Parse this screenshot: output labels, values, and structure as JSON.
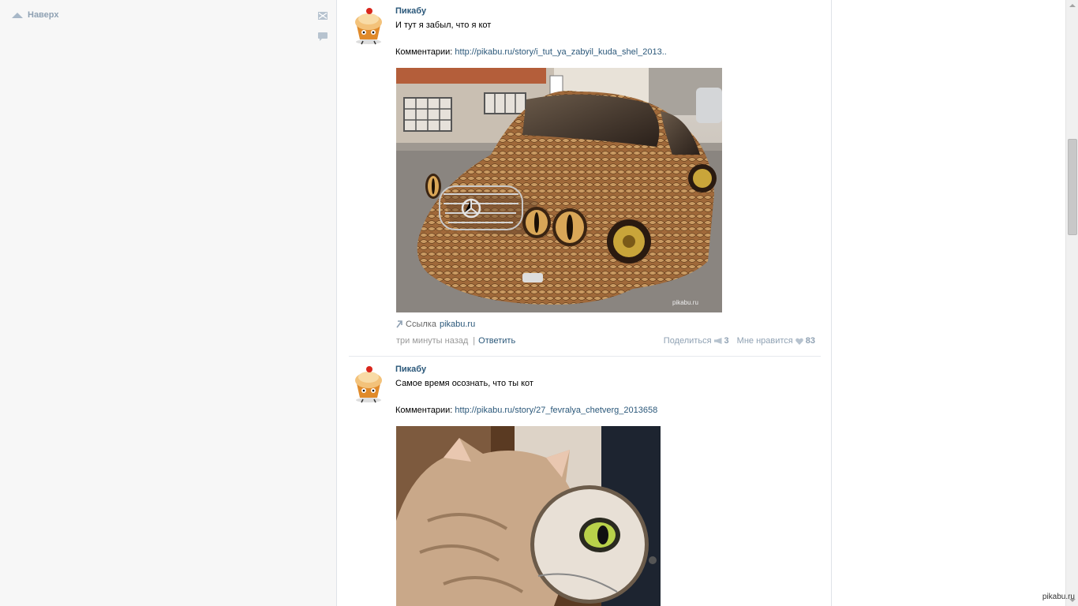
{
  "sidebar": {
    "to_top_label": "Наверх",
    "icons": [
      "envelope-icon",
      "chat-bubble-icon"
    ]
  },
  "posts": [
    {
      "author": "Пикабу",
      "text": "И тут я забыл, что я кот",
      "comments_label": "Комментарии:",
      "comments_link": "http://pikabu.ru/story/i_tut_ya_zabyil_kuda_shel_2013..",
      "image_alt": "Mercedes car painted in snake skin pattern",
      "source_prefix": "Ссылка",
      "source_domain": "pikabu.ru",
      "time": "три минуты назад",
      "separator": "|",
      "reply": "Ответить",
      "share_label": "Поделиться",
      "share_count": "3",
      "like_label": "Мне нравится",
      "like_count": "83"
    },
    {
      "author": "Пикабу",
      "text": "Самое время осознать, что ты кот",
      "comments_label": "Комментарии:",
      "comments_link": "http://pikabu.ru/story/27_fevralya_chetverg_2013658",
      "image_alt": "Cat looking into a magnifying mirror"
    }
  ],
  "watermark": "pikabu.ru",
  "colors": {
    "link": "#2b587a",
    "muted": "#8fa1b3",
    "bg": "#f7f7f7"
  }
}
